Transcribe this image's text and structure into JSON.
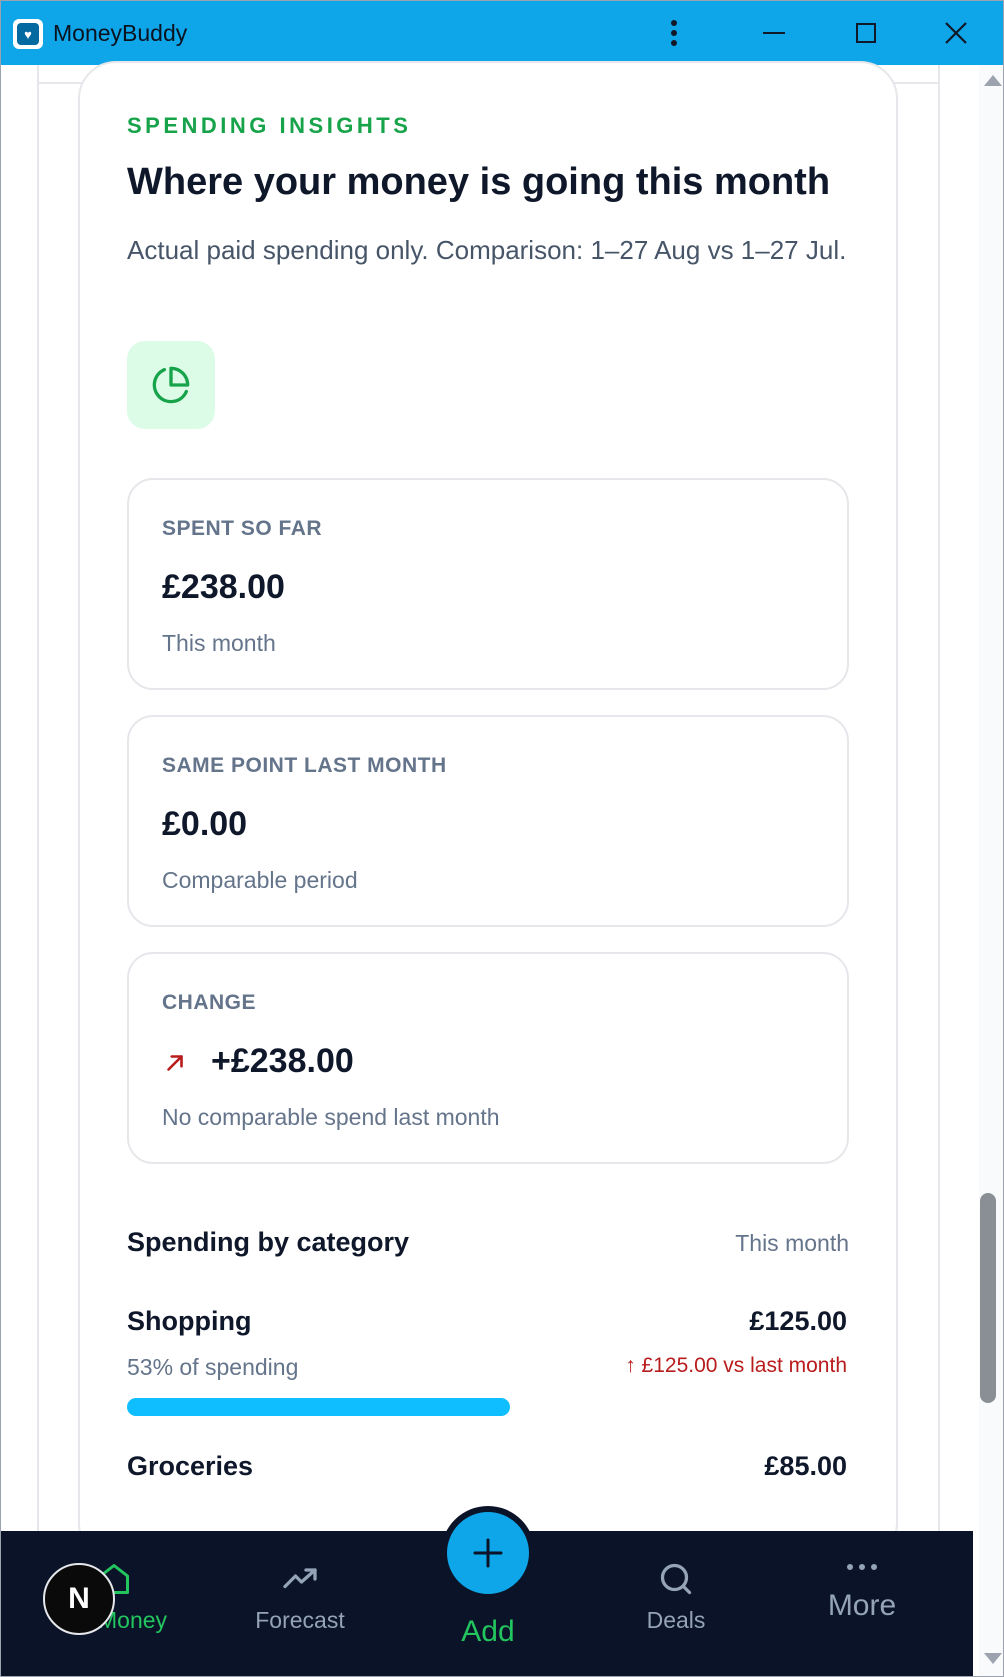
{
  "window": {
    "title": "MoneyBuddy"
  },
  "insights": {
    "eyebrow": "SPENDING INSIGHTS",
    "headline": "Where your money is going this month",
    "subtext": "Actual paid spending only. Comparison: 1–27 Aug vs 1–27 Jul."
  },
  "stats": [
    {
      "label": "SPENT SO FAR",
      "value": "£238.00",
      "note": "This month"
    },
    {
      "label": "SAME POINT LAST MONTH",
      "value": "£0.00",
      "note": "Comparable period"
    },
    {
      "label": "CHANGE",
      "value": "+£238.00",
      "note": "No comparable spend last month"
    }
  ],
  "category_section": {
    "title": "Spending by category",
    "period": "This month",
    "rows": [
      {
        "name": "Shopping",
        "amount": "£125.00",
        "share": "53% of spending",
        "delta": "↑ £125.00 vs last month",
        "fill_pct": 53
      },
      {
        "name": "Groceries",
        "amount": "£85.00"
      }
    ]
  },
  "nav": {
    "items": [
      {
        "label": "My Money"
      },
      {
        "label": "Forecast"
      },
      {
        "label": "Add"
      },
      {
        "label": "Deals"
      },
      {
        "label": "More"
      }
    ],
    "badge": "N"
  },
  "colors": {
    "titlebar": "#0ea5e9",
    "accent_green": "#16a34a",
    "bar_fill": "#0ebeff",
    "nav_bg": "#0b1328",
    "delta_red": "#b91c1c"
  },
  "icons": {
    "pie": "pie-chart-icon",
    "trend": "arrow-up-right-icon",
    "home": "home-icon",
    "forecast": "trending-up-icon",
    "add": "plus-icon",
    "deals": "search-icon",
    "more": "more-horizontal-icon"
  }
}
